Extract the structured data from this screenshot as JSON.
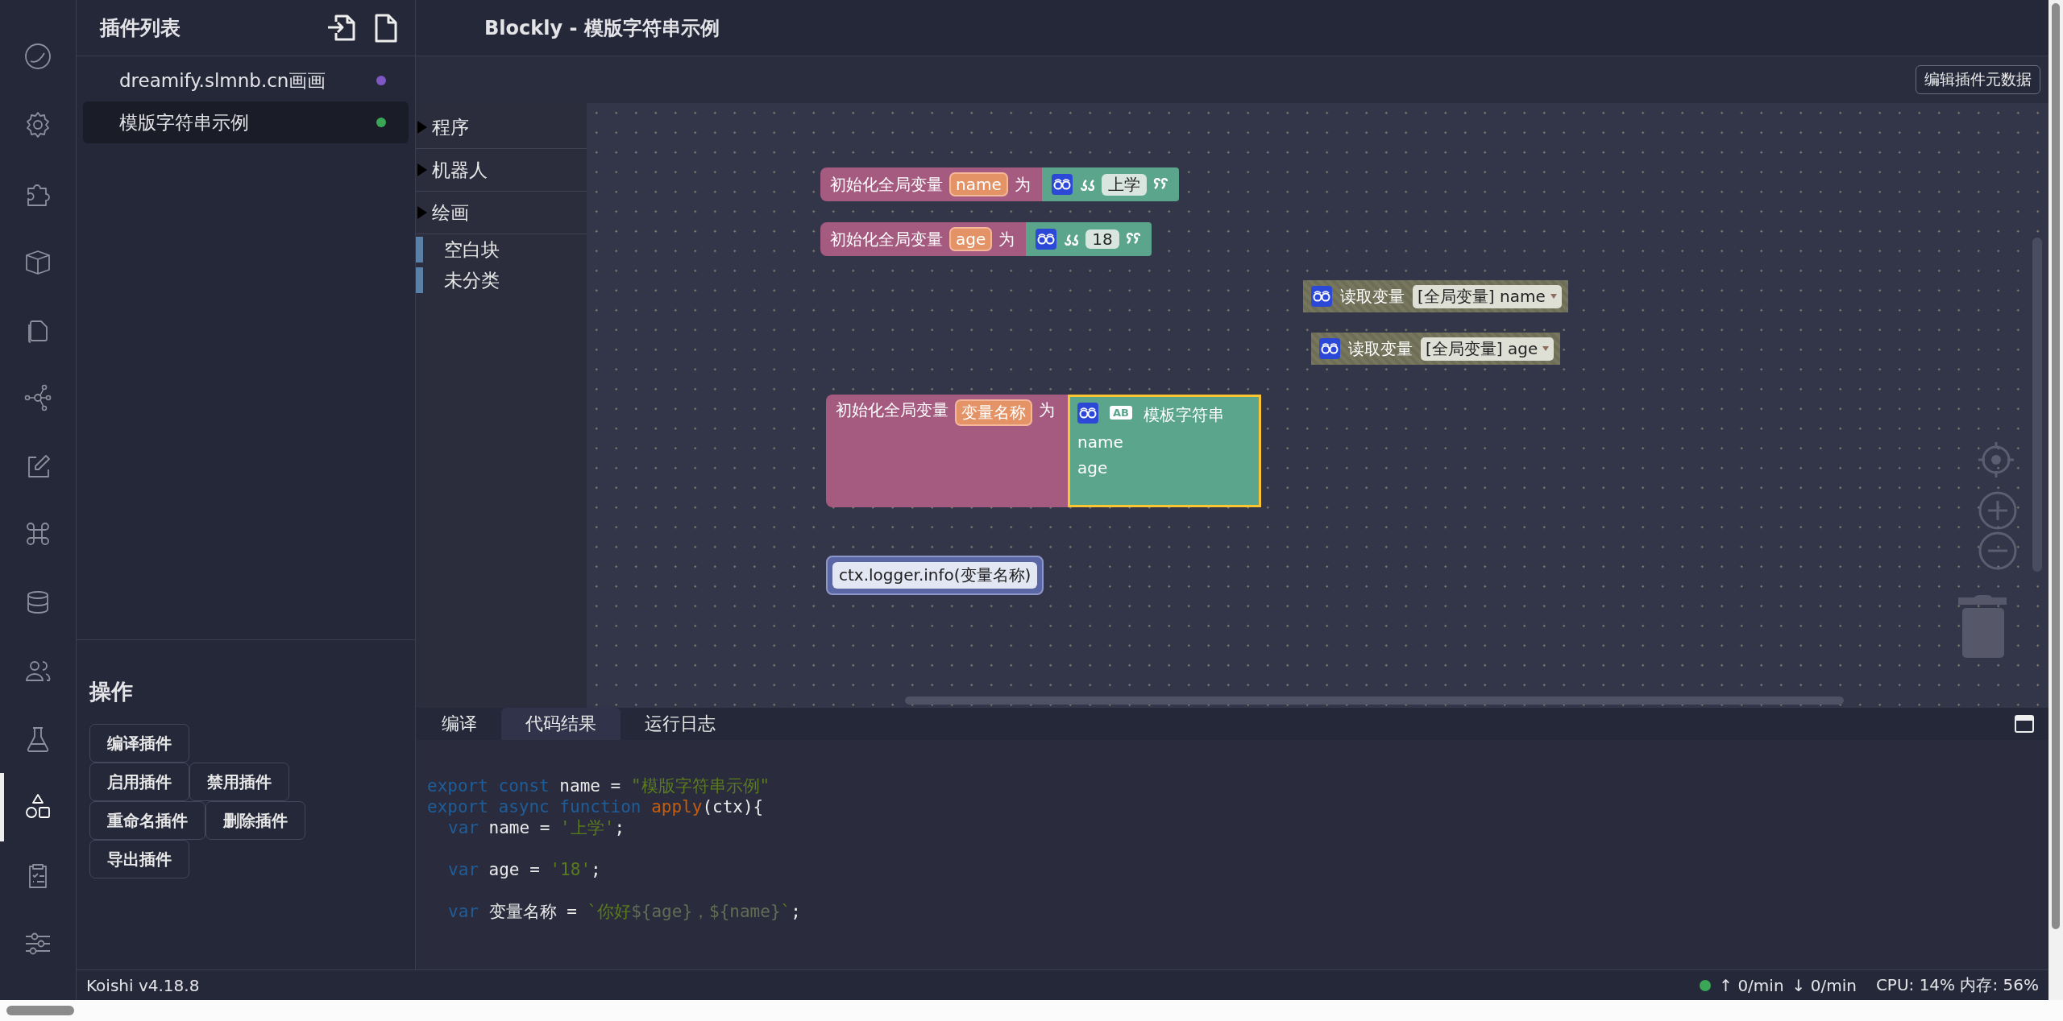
{
  "activity_bar": {
    "items": [
      {
        "kind": "gauge",
        "selected": false
      },
      {
        "kind": "gear",
        "selected": false
      },
      {
        "kind": "puzzle",
        "selected": false
      },
      {
        "kind": "box",
        "selected": false
      },
      {
        "kind": "files",
        "selected": false
      },
      {
        "kind": "network",
        "selected": false
      },
      {
        "kind": "edit",
        "selected": false
      },
      {
        "kind": "command",
        "selected": false
      },
      {
        "kind": "database",
        "selected": false
      },
      {
        "kind": "users",
        "selected": false
      },
      {
        "kind": "flask",
        "selected": false
      },
      {
        "kind": "shapes",
        "selected": true
      },
      {
        "kind": "clipboard",
        "selected": false
      }
    ],
    "bottom_items": [
      {
        "kind": "sliders",
        "selected": false
      }
    ]
  },
  "plugin_list": {
    "title": "插件列表",
    "items": [
      {
        "name": "dreamify.slmnb.cn画画",
        "color": "#7e57c2",
        "selected": false
      },
      {
        "name": "模版字符串示例",
        "color": "#3aa757",
        "selected": true
      }
    ]
  },
  "operations": {
    "title": "操作",
    "button_rows": [
      [
        "编译插件"
      ],
      [
        "启用插件",
        "禁用插件"
      ],
      [
        "重命名插件",
        "删除插件"
      ],
      [
        "导出插件"
      ]
    ]
  },
  "header": {
    "title": "Blockly - 模版字符串示例"
  },
  "toolbar": {
    "button": "编辑插件元数据"
  },
  "toolbox": {
    "categories": [
      {
        "kind": "folder",
        "label": "程序"
      },
      {
        "kind": "folder",
        "label": "机器人"
      },
      {
        "kind": "folder",
        "label": "绘画"
      },
      {
        "kind": "leaf",
        "label": "空白块"
      },
      {
        "kind": "leaf",
        "label": "未分类"
      }
    ]
  },
  "workspace": {
    "blocks": [
      {
        "kind": "init_var",
        "label": "初始化全局变量",
        "variable": "name",
        "connector": "为",
        "disabled": false,
        "value": {
          "kind": "text",
          "text": "上学",
          "selected": false
        }
      },
      {
        "kind": "init_var",
        "label": "初始化全局变量",
        "variable": "age",
        "connector": "为",
        "disabled": false,
        "value": {
          "kind": "text",
          "text": "18",
          "selected": false
        }
      },
      {
        "kind": "get_var",
        "label": "读取变量",
        "dropdown": "[全局变量] name",
        "disabled": true
      },
      {
        "kind": "get_var",
        "label": "读取变量",
        "dropdown": "[全局变量] age",
        "disabled": true
      },
      {
        "kind": "init_var",
        "label": "初始化全局变量",
        "variable": "变量名称",
        "connector": "为",
        "disabled": false,
        "value": {
          "kind": "template",
          "badge": "AB",
          "label": "模板字符串",
          "inputs": [
            "name",
            "age"
          ],
          "selected": true
        }
      },
      {
        "kind": "code",
        "text": "ctx.logger.info(变量名称)",
        "disabled": false
      }
    ]
  },
  "bottom_panel": {
    "tabs": [
      {
        "label": "编译",
        "selected": false
      },
      {
        "label": "代码结果",
        "selected": true
      },
      {
        "label": "运行日志",
        "selected": false
      }
    ],
    "code_lines": [
      {
        "indent": false,
        "blank_line_before": false,
        "tokens": [
          {
            "kind": "keyword",
            "text": "export const"
          },
          {
            "kind": "plain",
            "text": " name = "
          },
          {
            "kind": "string",
            "text": "\"模版字符串示例\""
          }
        ]
      },
      {
        "indent": false,
        "blank_line_before": false,
        "tokens": [
          {
            "kind": "keyword",
            "text": "export async function"
          },
          {
            "kind": "function",
            "text": " apply"
          },
          {
            "kind": "plain",
            "text": "(ctx){"
          }
        ]
      },
      {
        "indent": true,
        "blank_line_before": false,
        "tokens": [
          {
            "kind": "keyword",
            "text": "var"
          },
          {
            "kind": "plain",
            "text": " name = "
          },
          {
            "kind": "string",
            "text": "'上学'"
          },
          {
            "kind": "plain",
            "text": ";"
          }
        ]
      },
      {
        "indent": true,
        "blank_line_before": true,
        "tokens": [
          {
            "kind": "keyword",
            "text": "var"
          },
          {
            "kind": "plain",
            "text": " age = "
          },
          {
            "kind": "string",
            "text": "'18'"
          },
          {
            "kind": "plain",
            "text": ";"
          }
        ]
      },
      {
        "indent": true,
        "blank_line_before": true,
        "tokens": [
          {
            "kind": "keyword",
            "text": "var"
          },
          {
            "kind": "plain",
            "text": " 变量名称 = "
          },
          {
            "kind": "string",
            "text": "`你好"
          },
          {
            "kind": "dim",
            "text": "${age}，${name}"
          },
          {
            "kind": "string",
            "text": "`"
          },
          {
            "kind": "plain",
            "text": ";"
          }
        ]
      }
    ]
  },
  "status_bar": {
    "version": "Koishi v4.18.8",
    "connected": true,
    "upload": "↑ 0/min",
    "download": "↓ 0/min",
    "resources": "CPU: 14% 内存: 56%"
  }
}
